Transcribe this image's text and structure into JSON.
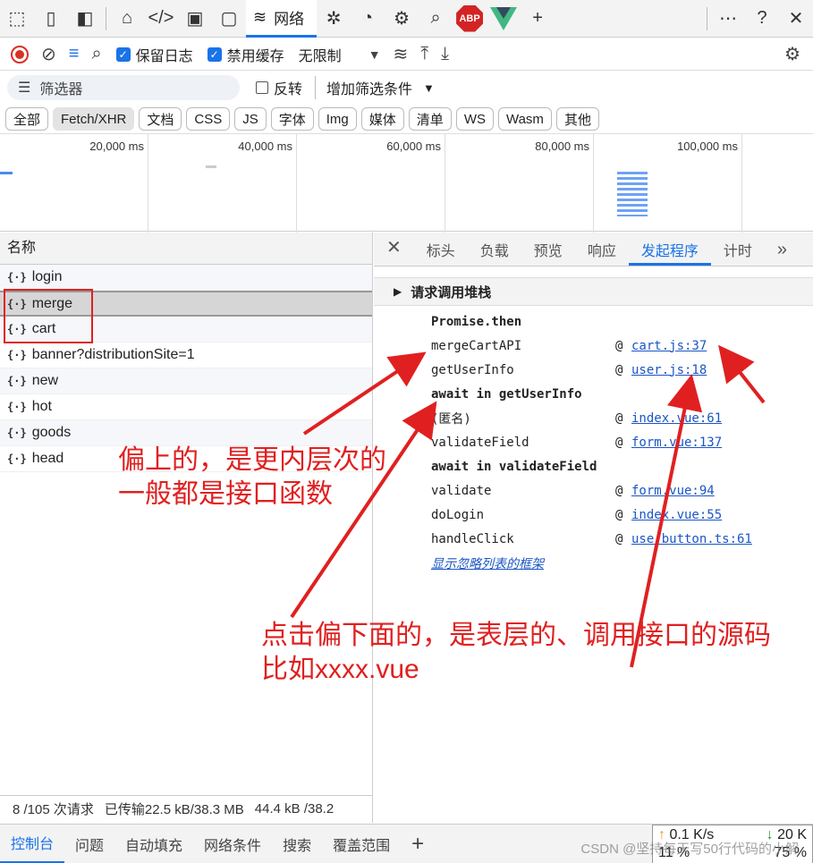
{
  "toolbar_top": {
    "network_tab_label": "网络",
    "abp_label": "ABP"
  },
  "toolbar2": {
    "preserve_log_label": "保留日志",
    "disable_cache_label": "禁用缓存",
    "throttle_label": "无限制"
  },
  "filter": {
    "placeholder": "筛选器",
    "invert_label": "反转",
    "more_filters_label": "增加筛选条件"
  },
  "type_chips": [
    "全部",
    "Fetch/XHR",
    "文档",
    "CSS",
    "JS",
    "字体",
    "Img",
    "媒体",
    "清单",
    "WS",
    "Wasm",
    "其他"
  ],
  "overview": {
    "ticks": [
      "20,000 ms",
      "40,000 ms",
      "60,000 ms",
      "80,000 ms",
      "100,000 ms"
    ]
  },
  "request_list": {
    "header": "名称",
    "rows": [
      "login",
      "merge",
      "cart",
      "banner?distributionSite=1",
      "new",
      "hot",
      "goods",
      "head"
    ],
    "selected": "merge"
  },
  "status_bar": {
    "requests": "8 /105 次请求",
    "transferred": "已传输22.5 kB/38.3 MB",
    "resources": "44.4 kB /38.2"
  },
  "detail_tabs": [
    "标头",
    "负载",
    "预览",
    "响应",
    "发起程序",
    "计时"
  ],
  "detail_active_tab": "发起程序",
  "stack": {
    "title": "请求调用堆栈",
    "frames": [
      {
        "type": "header",
        "text": "Promise.then"
      },
      {
        "type": "frame",
        "fn": "mergeCartAPI",
        "at": "@",
        "src": "cart.js:37"
      },
      {
        "type": "frame",
        "fn": "getUserInfo",
        "at": "@",
        "src": "user.js:18"
      },
      {
        "type": "header",
        "text": "await in getUserInfo"
      },
      {
        "type": "frame",
        "fn": "(匿名)",
        "at": "@",
        "src": "index.vue:61"
      },
      {
        "type": "frame",
        "fn": "validateField",
        "at": "@",
        "src": "form.vue:137"
      },
      {
        "type": "header",
        "text": "await in validateField"
      },
      {
        "type": "frame",
        "fn": "validate",
        "at": "@",
        "src": "form.vue:94"
      },
      {
        "type": "frame",
        "fn": "doLogin",
        "at": "@",
        "src": "index.vue:55"
      },
      {
        "type": "frame",
        "fn": "handleClick",
        "at": "@",
        "src": "use-button.ts:61"
      }
    ],
    "ignore_link": "显示忽略列表的框架"
  },
  "bottom_tabs": [
    "控制台",
    "问题",
    "自动填充",
    "网络条件",
    "搜索",
    "覆盖范围"
  ],
  "bottom_active": "控制台",
  "speed_widget": {
    "up": "0.1 K/s",
    "down": "20 K",
    "cpu": "11 %",
    "mem": "75 %"
  },
  "annotations": {
    "top_line1": "偏上的，是更内层次的",
    "top_line2": "一般都是接口函数",
    "bottom_line1": "点击偏下面的，是表层的、调用接口的源码",
    "bottom_line2": "比如xxxx.vue"
  },
  "watermark": "CSDN @坚持每天写50行代码的小解",
  "colors": {
    "accent": "#1a73e8",
    "annotation": "#e02020",
    "link": "#1a55c5"
  }
}
